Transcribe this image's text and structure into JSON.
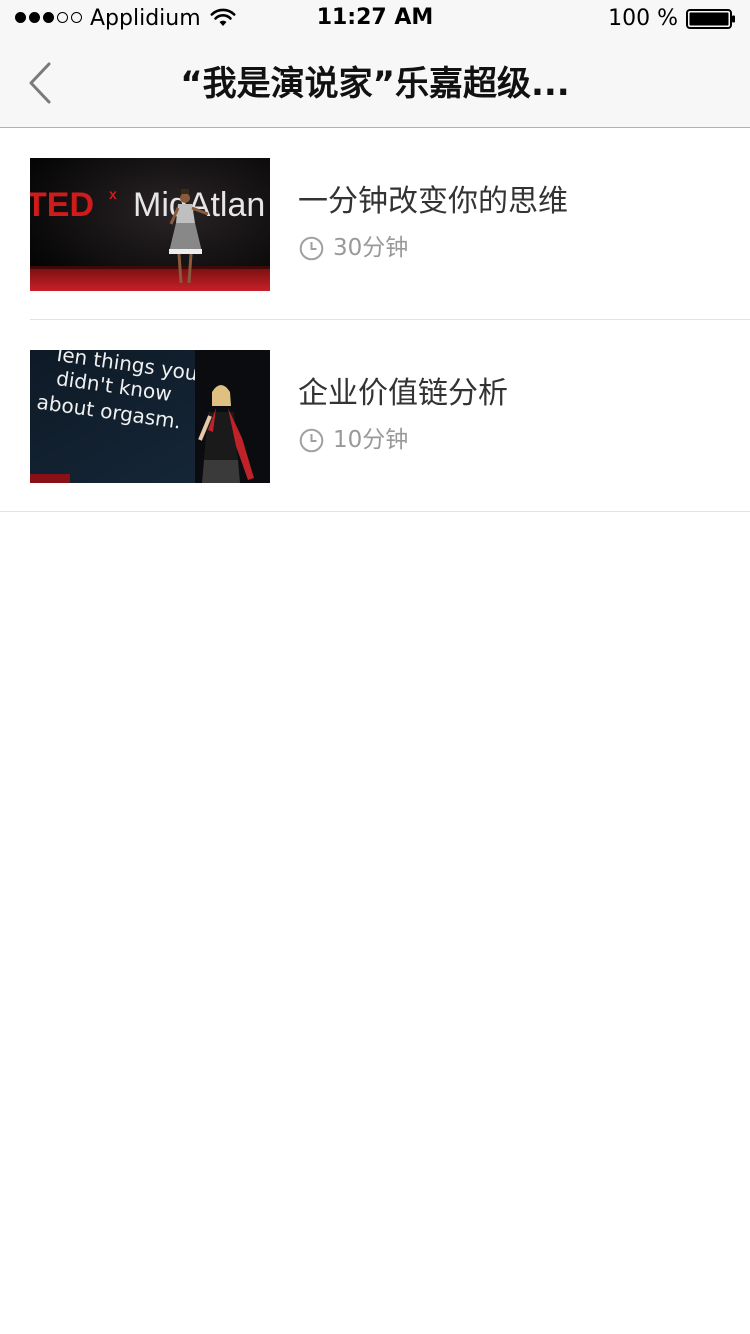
{
  "status_bar": {
    "carrier": "Applidium",
    "time": "11:27 AM",
    "battery": "100 %",
    "signal_bars_filled": 3,
    "signal_bars_total": 5,
    "battery_level": 1.0
  },
  "nav": {
    "title": "“我是演说家”乐嘉超级...",
    "back_icon": "chevron-left-icon"
  },
  "colors": {
    "bar_background": "#f7f7f7",
    "title_text": "#333333",
    "meta_text": "#999999",
    "divider": "#e2e2e2"
  },
  "videos": [
    {
      "title": "一分钟改变你的思维",
      "duration": "30分钟",
      "thumbnail": {
        "description_icon": "video-thumbnail",
        "overlay_text": "TEDx MidAtlan"
      }
    },
    {
      "title": "企业价值链分析",
      "duration": "10分钟",
      "thumbnail": {
        "description_icon": "video-thumbnail",
        "overlay_text": "Ten things you didn't know about orgasm."
      }
    }
  ]
}
